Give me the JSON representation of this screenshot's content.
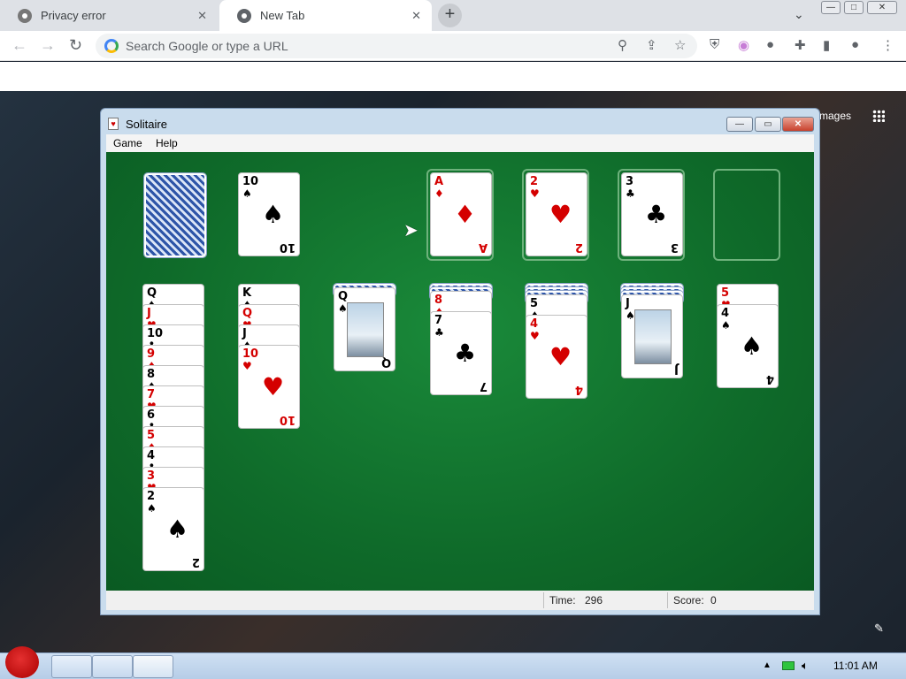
{
  "browser": {
    "tabs": [
      {
        "label": "Privacy error"
      },
      {
        "label": "New Tab"
      }
    ],
    "omnibox_placeholder": "Search Google or type a URL",
    "window_buttons": [
      "—",
      "□",
      "✕"
    ]
  },
  "newtab_page": {
    "images_link": "mages"
  },
  "solitaire": {
    "title": "Solitaire",
    "menu": [
      "Game",
      "Help"
    ],
    "status": {
      "time_label": "Time:",
      "time_value": "296",
      "score_label": "Score:",
      "score_value": "0"
    },
    "stock": {
      "face_down": true
    },
    "waste": {
      "rank": "10",
      "suit": "♠",
      "color": "black"
    },
    "foundations": [
      {
        "rank": "A",
        "suit": "♦",
        "color": "red"
      },
      {
        "rank": "2",
        "suit": "♥",
        "color": "red"
      },
      {
        "rank": "3",
        "suit": "♣",
        "color": "black"
      },
      {
        "empty": true
      }
    ],
    "tableau": [
      {
        "hidden": 0,
        "cards": [
          {
            "rank": "Q",
            "suit": "♠",
            "color": "black"
          },
          {
            "rank": "J",
            "suit": "♥",
            "color": "red"
          },
          {
            "rank": "10",
            "suit": "♣",
            "color": "black"
          },
          {
            "rank": "9",
            "suit": "♦",
            "color": "red"
          },
          {
            "rank": "8",
            "suit": "♠",
            "color": "black"
          },
          {
            "rank": "7",
            "suit": "♥",
            "color": "red"
          },
          {
            "rank": "6",
            "suit": "♣",
            "color": "black"
          },
          {
            "rank": "5",
            "suit": "♦",
            "color": "red"
          },
          {
            "rank": "4",
            "suit": "♣",
            "color": "black"
          },
          {
            "rank": "3",
            "suit": "♥",
            "color": "red"
          },
          {
            "rank": "2",
            "suit": "♠",
            "color": "black"
          }
        ]
      },
      {
        "hidden": 0,
        "cards": [
          {
            "rank": "K",
            "suit": "♠",
            "color": "black"
          },
          {
            "rank": "Q",
            "suit": "♥",
            "color": "red"
          },
          {
            "rank": "J",
            "suit": "♠",
            "color": "black"
          },
          {
            "rank": "10",
            "suit": "♥",
            "color": "red"
          }
        ]
      },
      {
        "hidden": 1,
        "cards": [
          {
            "rank": "Q",
            "suit": "♠",
            "color": "black"
          }
        ]
      },
      {
        "hidden": 2,
        "cards": [
          {
            "rank": "8",
            "suit": "♦",
            "color": "red"
          },
          {
            "rank": "7",
            "suit": "♣",
            "color": "black"
          }
        ]
      },
      {
        "hidden": 3,
        "cards": [
          {
            "rank": "5",
            "suit": "♠",
            "color": "black"
          },
          {
            "rank": "4",
            "suit": "♥",
            "color": "red"
          }
        ]
      },
      {
        "hidden": 3,
        "cards": [
          {
            "rank": "J",
            "suit": "♠",
            "color": "black"
          }
        ]
      },
      {
        "hidden": 0,
        "cards": [
          {
            "rank": "5",
            "suit": "♥",
            "color": "red"
          },
          {
            "rank": "4",
            "suit": "♠",
            "color": "black"
          }
        ]
      }
    ]
  },
  "taskbar": {
    "clock": "11:01 AM"
  },
  "colors": {
    "felt": "#0f6b2a",
    "red_suit": "#d40000",
    "black_suit": "#000000"
  }
}
